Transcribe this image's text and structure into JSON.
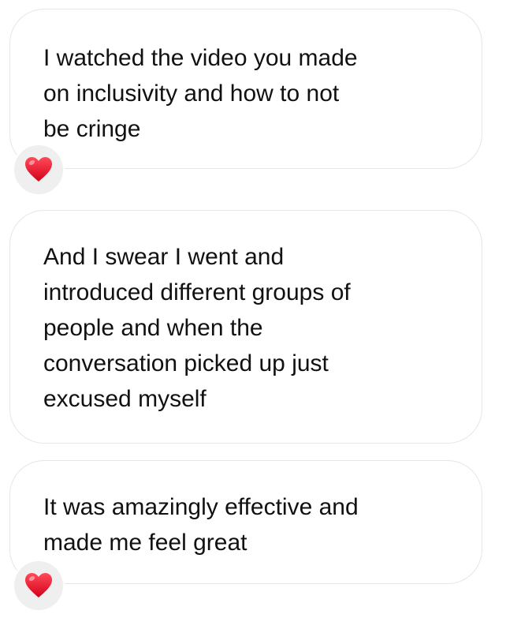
{
  "messages": [
    {
      "text": "I watched the video you made\non inclusivity and how to not\nbe cringe",
      "reaction": "heart-icon"
    },
    {
      "text": "And I swear I went and\nintroduced different groups of\npeople and when the\nconversation picked up just\nexcused myself",
      "reaction": null
    },
    {
      "text": "It was amazingly effective and\nmade me feel great",
      "reaction": "heart-icon"
    }
  ],
  "colors": {
    "bubble_border": "#e6e6e6",
    "reaction_bg": "#efefef",
    "heart": "#e8122c",
    "text": "#111111"
  }
}
